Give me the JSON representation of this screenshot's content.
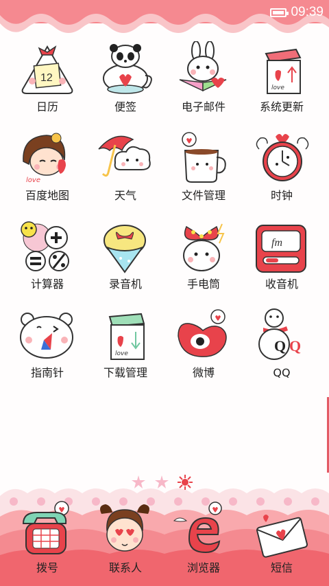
{
  "status_bar": {
    "time": "09:39"
  },
  "apps": [
    {
      "label": "日历",
      "icon": "calendar-icon"
    },
    {
      "label": "便签",
      "icon": "panda-teapot-icon"
    },
    {
      "label": "电子邮件",
      "icon": "bunny-envelope-icon"
    },
    {
      "label": "系统更新",
      "icon": "milk-box-icon"
    },
    {
      "label": "百度地图",
      "icon": "girl-map-icon"
    },
    {
      "label": "天气",
      "icon": "umbrella-cloud-icon"
    },
    {
      "label": "文件管理",
      "icon": "coffee-mug-icon"
    },
    {
      "label": "时钟",
      "icon": "alarm-clock-icon"
    },
    {
      "label": "计算器",
      "icon": "calculator-icon"
    },
    {
      "label": "录音机",
      "icon": "ice-cream-icon"
    },
    {
      "label": "手电筒",
      "icon": "bow-bulb-icon"
    },
    {
      "label": "收音机",
      "icon": "radio-icon"
    },
    {
      "label": "指南针",
      "icon": "bear-compass-icon"
    },
    {
      "label": "下载管理",
      "icon": "download-box-icon"
    },
    {
      "label": "微博",
      "icon": "weibo-icon"
    },
    {
      "label": "QQ",
      "icon": "snowman-qq-icon"
    }
  ],
  "pager": {
    "pages": 3,
    "current": 3
  },
  "dock": [
    {
      "label": "拨号",
      "icon": "phone-icon"
    },
    {
      "label": "联系人",
      "icon": "girl-contacts-icon"
    },
    {
      "label": "浏览器",
      "icon": "browser-e-icon"
    },
    {
      "label": "短信",
      "icon": "envelope-heart-icon"
    }
  ],
  "icon_text": {
    "calendar_day": "12",
    "love": "love",
    "fm": "fm",
    "q1": "Q",
    "q2": "Q"
  },
  "colors": {
    "accent": "#f2737b",
    "wave": "#f7c3c6",
    "dock": "#f47a80"
  }
}
